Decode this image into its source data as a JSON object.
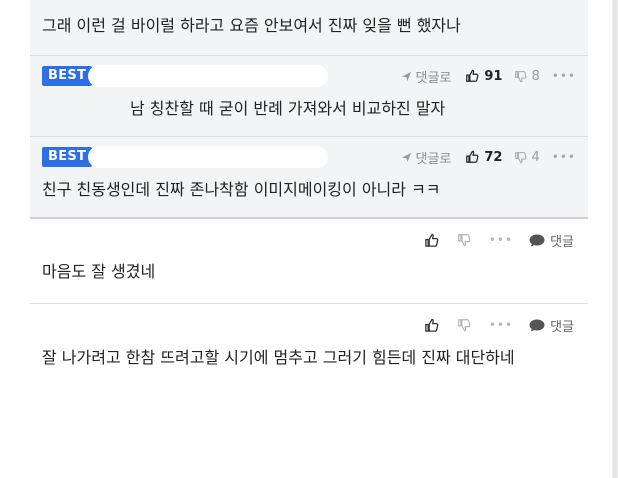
{
  "comments": {
    "top": {
      "text": "그래 이런 걸 바이럴 하라고 요즘 안보여서 진짜 잊을 뻔 했자나"
    },
    "best1": {
      "badge": "BEST",
      "reply_label": "댓글로",
      "likes": "91",
      "dislikes": "8",
      "more": "•••",
      "text": "남 칭찬할 때 굳이 반례 가져와서 비교하진 말자"
    },
    "best2": {
      "badge": "BEST",
      "reply_label": "댓글로",
      "likes": "72",
      "dislikes": "4",
      "more": "•••",
      "text": "친구 친동생인데 진짜 존나착함 이미지메이킹이 아니라 ㅋㅋ"
    },
    "c1": {
      "more": "•••",
      "reply_label": "댓글",
      "text": "마음도 잘 생겼네"
    },
    "c2": {
      "more": "•••",
      "reply_label": "댓글",
      "text": "잘 나가려고 한참 뜨려고할 시기에 멈추고 그러기 힘든데 진짜 대단하네"
    }
  },
  "colors": {
    "best_badge": "#2f6fe4",
    "gray_block": "#f3f4f6"
  },
  "icons": [
    "reply-arrow-icon",
    "thumbs-up-icon",
    "thumbs-down-icon",
    "more-dots-icon",
    "speech-bubble-icon"
  ]
}
